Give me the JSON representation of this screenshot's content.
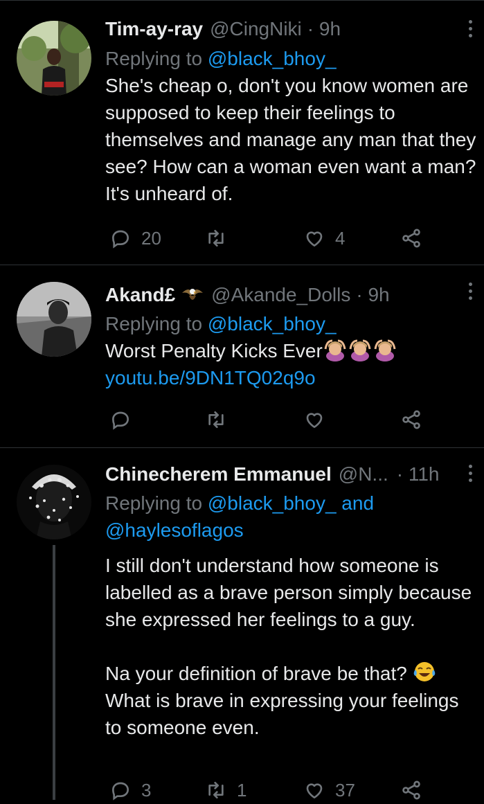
{
  "tweets": [
    {
      "name": "Tim-ay-ray",
      "handle": "@CingNiki",
      "time": "· 9h",
      "replying_label": "Replying to ",
      "replying_to": "@black_bhoy_",
      "body": "She's cheap o, don't you know women are supposed to keep their feelings to themselves and manage any man that they see? How can a woman even want a man? It's unheard of.",
      "replies": "20",
      "retweets": "",
      "likes": "4"
    },
    {
      "name": "Akand£",
      "handle": "@Akande_Dolls",
      "time": "· 9h",
      "replying_label": "Replying to ",
      "replying_to": "@black_bhoy_",
      "body": "Worst Penalty Kicks Ever",
      "link": "youtu.be/9DN1TQ02q9o",
      "replies": "",
      "retweets": "",
      "likes": ""
    },
    {
      "name": "Chinecherem Emmanuel",
      "handle": "@N...",
      "time": "· 11h",
      "replying_label": "Replying to ",
      "replying_to": "@black_bhoy_",
      "replying_and": " and",
      "replying_to_2": "@haylesoflagos",
      "body_p1": "I still don't understand how someone is labelled as a brave person simply because she expressed her feelings to a guy.",
      "body_p2_line1": "Na your definition of brave be that?",
      "body_p2_rest": "What is brave in expressing your feelings to someone even.",
      "replies": "3",
      "retweets": "1",
      "likes": "37"
    }
  ],
  "icons": {
    "reply": "reply-icon",
    "retweet": "retweet-icon",
    "like": "heart-icon",
    "share": "share-icon",
    "more": "more-options-icon",
    "eagle": "eagle-emoji",
    "facepalm": "woman-gesturing-ok-emoji",
    "laugh": "face-with-tears-of-joy-emoji"
  },
  "colors": {
    "background": "#000000",
    "text": "#e8e9ea",
    "muted": "#71767b",
    "link": "#1d9bf0",
    "divider": "#2f3336"
  }
}
